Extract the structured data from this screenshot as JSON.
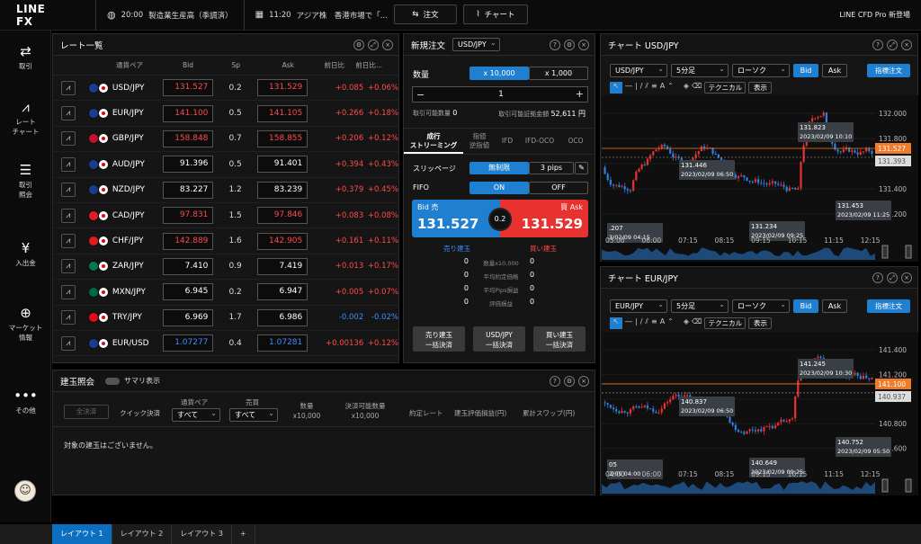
{
  "app": {
    "logo": "LINE FX",
    "brand": "LINE CFD Pro 新登場"
  },
  "news": [
    {
      "time": "20:00",
      "text": "製造業生産高（季調済）"
    },
    {
      "time": "11:20",
      "text": "アジア株　香港市場で「..."
    }
  ],
  "toolbar": {
    "order": "注文",
    "chart": "チャート"
  },
  "sidebar": [
    {
      "label": "取引",
      "icon": "arrows-icon"
    },
    {
      "label": "レート\nチャート",
      "icon": "chart-line-icon"
    },
    {
      "label": "取引\n照会",
      "icon": "list-icon"
    },
    {
      "label": "入出金",
      "icon": "yen-icon"
    },
    {
      "label": "マーケット\n情報",
      "icon": "globe-icon"
    },
    {
      "label": "その他",
      "icon": "dots-icon"
    }
  ],
  "rates": {
    "title": "レート一覧",
    "headers": [
      "通貨ペア",
      "Bid",
      "Sp",
      "Ask",
      "前日比",
      "前日比..."
    ],
    "rows": [
      {
        "pair": "USD/JPY",
        "bid": "131.527",
        "sp": "0.2",
        "ask": "131.529",
        "chg": "+0.085",
        "pct": "+0.06%",
        "c": "red",
        "f1": "#1a3c8f",
        "f2": "#e60012"
      },
      {
        "pair": "EUR/JPY",
        "bid": "141.100",
        "sp": "0.5",
        "ask": "141.105",
        "chg": "+0.266",
        "pct": "+0.18%",
        "c": "red",
        "f1": "#1a3c8f",
        "f2": "#e60012"
      },
      {
        "pair": "GBP/JPY",
        "bid": "158.848",
        "sp": "0.7",
        "ask": "158.855",
        "chg": "+0.206",
        "pct": "+0.12%",
        "c": "red",
        "f1": "#c8102e",
        "f2": "#e60012"
      },
      {
        "pair": "AUD/JPY",
        "bid": "91.396",
        "sp": "0.5",
        "ask": "91.401",
        "chg": "+0.394",
        "pct": "+0.43%",
        "c": "white",
        "f1": "#1a3c8f",
        "f2": "#e60012"
      },
      {
        "pair": "NZD/JPY",
        "bid": "83.227",
        "sp": "1.2",
        "ask": "83.239",
        "chg": "+0.379",
        "pct": "+0.45%",
        "c": "white",
        "f1": "#1a3c8f",
        "f2": "#e60012"
      },
      {
        "pair": "CAD/JPY",
        "bid": "97.831",
        "sp": "1.5",
        "ask": "97.846",
        "chg": "+0.083",
        "pct": "+0.08%",
        "c": "red",
        "f1": "#e31b23",
        "f2": "#e60012"
      },
      {
        "pair": "CHF/JPY",
        "bid": "142.889",
        "sp": "1.6",
        "ask": "142.905",
        "chg": "+0.161",
        "pct": "+0.11%",
        "c": "red",
        "f1": "#e31b23",
        "f2": "#e60012"
      },
      {
        "pair": "ZAR/JPY",
        "bid": "7.410",
        "sp": "0.9",
        "ask": "7.419",
        "chg": "+0.013",
        "pct": "+0.17%",
        "c": "white",
        "f1": "#007a4d",
        "f2": "#e60012"
      },
      {
        "pair": "MXN/JPY",
        "bid": "6.945",
        "sp": "0.2",
        "ask": "6.947",
        "chg": "+0.005",
        "pct": "+0.07%",
        "c": "white",
        "f1": "#006847",
        "f2": "#e60012"
      },
      {
        "pair": "TRY/JPY",
        "bid": "6.969",
        "sp": "1.7",
        "ask": "6.986",
        "chg": "-0.002",
        "pct": "-0.02%",
        "c": "white",
        "f1": "#e30a17",
        "f2": "#e60012"
      },
      {
        "pair": "EUR/USD",
        "bid": "1.07277",
        "sp": "0.4",
        "ask": "1.07281",
        "chg": "+0.00136",
        "pct": "+0.12%",
        "c": "blue",
        "f1": "#1a3c8f",
        "f2": "#b22234"
      }
    ]
  },
  "order": {
    "title": "新規注文",
    "pair": "USD/JPY",
    "qty_label": "数量",
    "qty_opt1": "x 10,000",
    "qty_opt2": "x 1,000",
    "qty": "1",
    "avail_label": "取引可能数量",
    "avail": "0",
    "margin_label": "取引可能証拠金額",
    "margin": "52,611 円",
    "tabs": [
      "成行\nストリーミング",
      "指値\n逆指値",
      "IFD",
      "IFD-OCO",
      "OCO"
    ],
    "slip_label": "スリッページ",
    "slip_opt1": "無制限",
    "slip_opt2": "3 pips",
    "fifo_label": "FIFO",
    "fifo_on": "ON",
    "fifo_off": "OFF",
    "bid_label": "Bid 売",
    "bid": "131.527",
    "ask_label": "買 Ask",
    "ask": "131.529",
    "spread": "0.2",
    "sell_pos": "売り建玉",
    "buy_pos": "買い建玉",
    "stats": [
      {
        "label": "数量x10,000",
        "s": "0",
        "b": "0"
      },
      {
        "label": "平均約定価格",
        "s": "0",
        "b": "0"
      },
      {
        "label": "平均Pips損益",
        "s": "0",
        "b": "0"
      },
      {
        "label": "評価損益",
        "s": "0",
        "b": "0"
      }
    ],
    "btn_sell": "売り建玉\n一括決済",
    "btn_pair": "USD/JPY\n一括決済",
    "btn_buy": "買い建玉\n一括決済"
  },
  "positions": {
    "title": "建玉照会",
    "summary": "サマリ表示",
    "settle": "全決済",
    "quick": "クイック決済",
    "pair_label": "通貨ペア",
    "side_label": "売買",
    "all1": "すべて",
    "all2": "すべて",
    "headers": [
      "数量\nx10,000",
      "決済可能数量\nx10,000",
      "約定レート",
      "建玉評価損益(円)",
      "累計スワップ(円)"
    ],
    "empty": "対象の建玉はございません。"
  },
  "chart1": {
    "title": "チャート USD/JPY",
    "pair": "USD/JPY",
    "tf": "5分足",
    "type": "ローソク",
    "bid": "Bid",
    "ask": "Ask",
    "ind": "指標注文",
    "tech": "テクニカル",
    "disp": "表示",
    "yticks": [
      "132.000",
      "131.800",
      "131.600",
      "131.400",
      "131.200"
    ],
    "xticks": [
      "05:00",
      "06:00",
      "07:15",
      "08:15",
      "09:15",
      "10:15",
      "11:15",
      "12:15"
    ],
    "price_tag": "131.527",
    "ask_tag": "131.393",
    "labels": [
      {
        "p": "131.823",
        "t": "2023/02/09 10:10"
      },
      {
        "p": "131.446",
        "t": "2023/02/09 06:50"
      },
      {
        "p": "131.453",
        "t": "2023/02/09 11:25"
      },
      {
        "p": "131.234",
        "t": "2023/02/09 09:25"
      },
      {
        "p": ".207",
        "t": "3/02/09 04:15"
      }
    ]
  },
  "chart2": {
    "title": "チャート EUR/JPY",
    "pair": "EUR/JPY",
    "tf": "5分足",
    "type": "ローソク",
    "bid": "Bid",
    "ask": "Ask",
    "ind": "指標注文",
    "tech": "テクニカル",
    "disp": "表示",
    "yticks": [
      "141.400",
      "141.200",
      "141.000",
      "140.800",
      "140.600"
    ],
    "xticks": [
      "04:00",
      "06:00",
      "07:15",
      "08:15",
      "09:15",
      "10:15",
      "11:15",
      "12:15"
    ],
    "price_tag": "141.100",
    "ask_tag": "140.937",
    "labels": [
      {
        "p": "141.245",
        "t": "2023/02/09 10:30"
      },
      {
        "p": "140.837",
        "t": "2023/02/09 06:50"
      },
      {
        "p": "140.752",
        "t": "2023/02/09 05:50"
      },
      {
        "p": "140.649",
        "t": "2023/02/09 09:25"
      },
      {
        "p": "05",
        "t": "2/09 04:00"
      }
    ]
  },
  "layout_tabs": [
    "レイアウト 1",
    "レイアウト 2",
    "レイアウト 3",
    "+"
  ]
}
